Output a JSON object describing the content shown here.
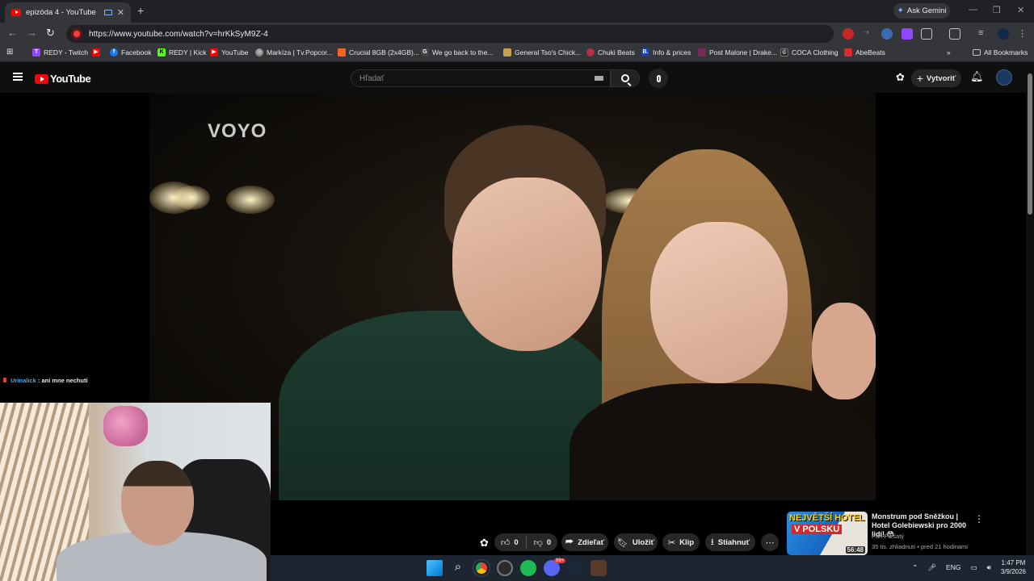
{
  "browser": {
    "tab_title": "epizóda 4 - YouTube",
    "new_tab_icon": "plus-icon",
    "ask_gemini_label": "Ask Gemini",
    "url": "https://www.youtube.com/watch?v=hrKkSyM9Z-4",
    "bookmarks": [
      {
        "label": "REDY - Twitch",
        "color": "#9146ff",
        "glyph": "T"
      },
      {
        "label": "",
        "color": "#ff0000",
        "glyph": "▶"
      },
      {
        "label": "Facebook",
        "color": "#1877f2",
        "glyph": "f"
      },
      {
        "label": "REDY | Kick",
        "color": "#53fc18",
        "glyph": "K"
      },
      {
        "label": "YouTube",
        "color": "#ff0000",
        "glyph": "▶"
      },
      {
        "label": "Markíza | Tv.Popcor...",
        "color": "#888888",
        "glyph": "◎"
      },
      {
        "label": "Crucial 8GB (2x4GB)...",
        "color": "#f26522",
        "glyph": ""
      },
      {
        "label": "We go back to the...",
        "color": "#444444",
        "glyph": "G"
      },
      {
        "label": "General Tso's Chick...",
        "color": "#c7a24b",
        "glyph": ""
      },
      {
        "label": "Chuki Beats",
        "color": "#b4304a",
        "glyph": ""
      },
      {
        "label": "Info & prices",
        "color": "#1e40af",
        "glyph": "B."
      },
      {
        "label": "Post Malone | Drake...",
        "color": "#7a2a5a",
        "glyph": ""
      },
      {
        "label": "COCA Clothing",
        "color": "#222222",
        "glyph": "©"
      },
      {
        "label": "AbeBeats",
        "color": "#d62d2d",
        "glyph": ""
      }
    ],
    "all_bookmarks_label": "All Bookmarks"
  },
  "youtube": {
    "logo_text": "YouTube",
    "search_placeholder": "Hľadať",
    "create_label": "Vytvoriť",
    "video_watermark": "VOYO",
    "actions": {
      "like_count": "0",
      "dislike_count": "0",
      "share_label": "Zdieľať",
      "save_label": "Uložiť",
      "clip_label": "Klip",
      "download_label": "Stiahnuť"
    },
    "recommendation": {
      "thumb_line1": "NEJVĚTŠÍ HOTEL",
      "thumb_line2": "V POLSKU",
      "duration": "56:48",
      "title": "Monstrum pod Sněžkou | Hotel Golebiewski pro 2000 lidí! 😳",
      "channel": "Pan Plešatý",
      "meta": "35 tis. zhliadnutí • pred 21 hodinami"
    }
  },
  "stream_overlay": {
    "chat_user": "Urinalick",
    "chat_message": ": ani mne nechutí"
  },
  "taskbar": {
    "language": "ENG",
    "time": "1:47 PM",
    "date": "3/9/2026",
    "discord_badge": "99+"
  },
  "colors": {
    "brand_red": "#ff0000",
    "link_blue": "#3ea6ff",
    "chrome_dark": "#202124",
    "chrome_toolbar": "#35363a"
  }
}
